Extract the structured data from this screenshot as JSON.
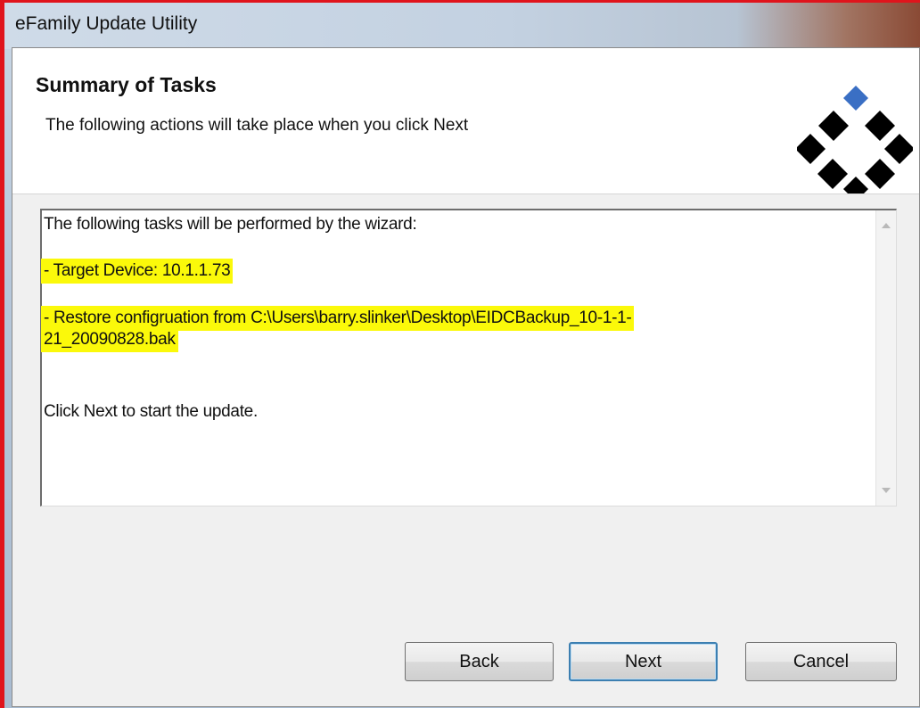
{
  "window": {
    "title": "eFamily Update Utility"
  },
  "header": {
    "title": "Summary of Tasks",
    "subtitle": "The following actions will take place when you click Next"
  },
  "summary": {
    "intro": "The following tasks will be performed by the wizard:",
    "target_device": "- Target Device: 10.1.1.73",
    "restore_line1": "- Restore configruation from C:\\Users\\barry.slinker\\Desktop\\EIDCBackup_10-1-1-",
    "restore_line2": "21_20090828.bak",
    "footer": "Click Next to start the update.",
    "highlight_color": "#fbf90a"
  },
  "buttons": {
    "back": "Back",
    "next": "Next",
    "cancel": "Cancel"
  },
  "colors": {
    "logo_accent": "#3a6fc4",
    "logo_main": "#000000"
  }
}
